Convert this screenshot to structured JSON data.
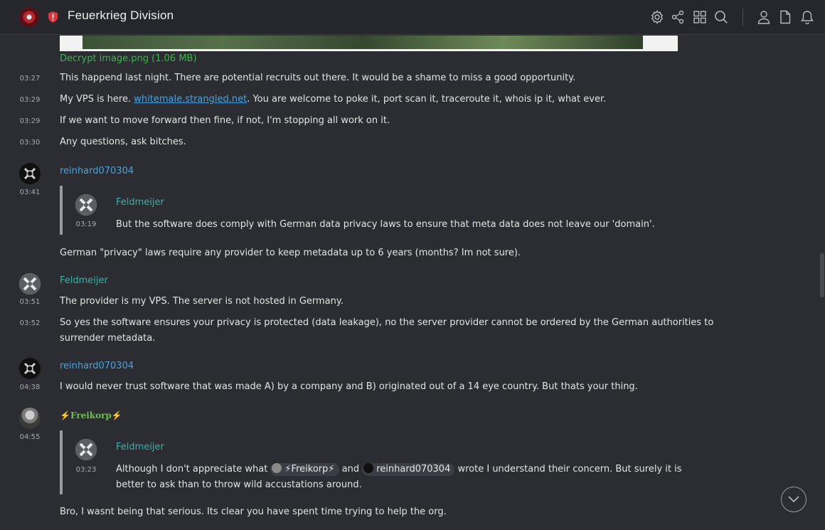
{
  "header": {
    "room_name": "Feuerkrieg Division",
    "icons": [
      "settings-icon",
      "share-icon",
      "grid-icon",
      "search-icon",
      "user-icon",
      "file-icon",
      "bell-icon"
    ]
  },
  "colors": {
    "link": "#4aa3df",
    "teal_name": "#36b3a8",
    "green_name": "#6cc24a",
    "attachment": "#3fb34f",
    "background": "#2b2d32"
  },
  "attachment": {
    "caption": "Decrypt image.png (1.06 MB)"
  },
  "messages": [
    {
      "time": "03:27",
      "text": "This happend last night. There are potential recruits out there. It would be a shame to miss a good opportunity."
    },
    {
      "time": "03:29",
      "text_before": "My VPS is here. ",
      "link": "whitemale.strangled.net",
      "text_after": ". You are welcome to poke it, port scan it, traceroute it, whois ip it, what ever."
    },
    {
      "time": "03:29",
      "text": "If we want to move forward then fine, if not, I'm stopping all work on it."
    },
    {
      "time": "03:30",
      "text": "Any questions, ask bitches."
    }
  ],
  "reinhard_1": {
    "sender": "reinhard070304",
    "time": "03:41",
    "quote": {
      "sender": "Feldmeijer",
      "time": "03:19",
      "text": "But the software does comply with German data privacy laws to ensure that meta data does not leave our 'domain'."
    },
    "text": "German \"privacy\" laws require any provider to keep metadata up to 6 years (months? Im not sure)."
  },
  "feldmeijer_1": {
    "sender": "Feldmeijer",
    "messages": [
      {
        "time": "03:51",
        "text": "The provider is my VPS. The server is not hosted in Germany."
      },
      {
        "time": "03:52",
        "text_line1": "So yes the software ensures your privacy is protected (data leakage), no the server provider cannot be ordered by the German authorities to",
        "text_line2": "surrender metadata."
      }
    ]
  },
  "reinhard_2": {
    "sender": "reinhard070304",
    "time": "04:38",
    "text": "I would never trust software that was made A) by a company and B) originated out of a 14 eye country. But thats your thing."
  },
  "freikorp": {
    "sender": "⚡Freikorp⚡",
    "time": "04:55",
    "quote": {
      "sender": "Feldmeijer",
      "time": "03:23",
      "text_a": "Although I don't appreciate what ",
      "mention_1": "⚡Freikorp⚡",
      "text_b": " and ",
      "mention_2": "reinhard070304",
      "text_c": " wrote I understand their concern. But surely it is",
      "text_line2": "better to ask than to throw wild accustations around."
    },
    "text": "Bro, I wasnt being that serious. Its clear you have spent time trying to help the org."
  }
}
